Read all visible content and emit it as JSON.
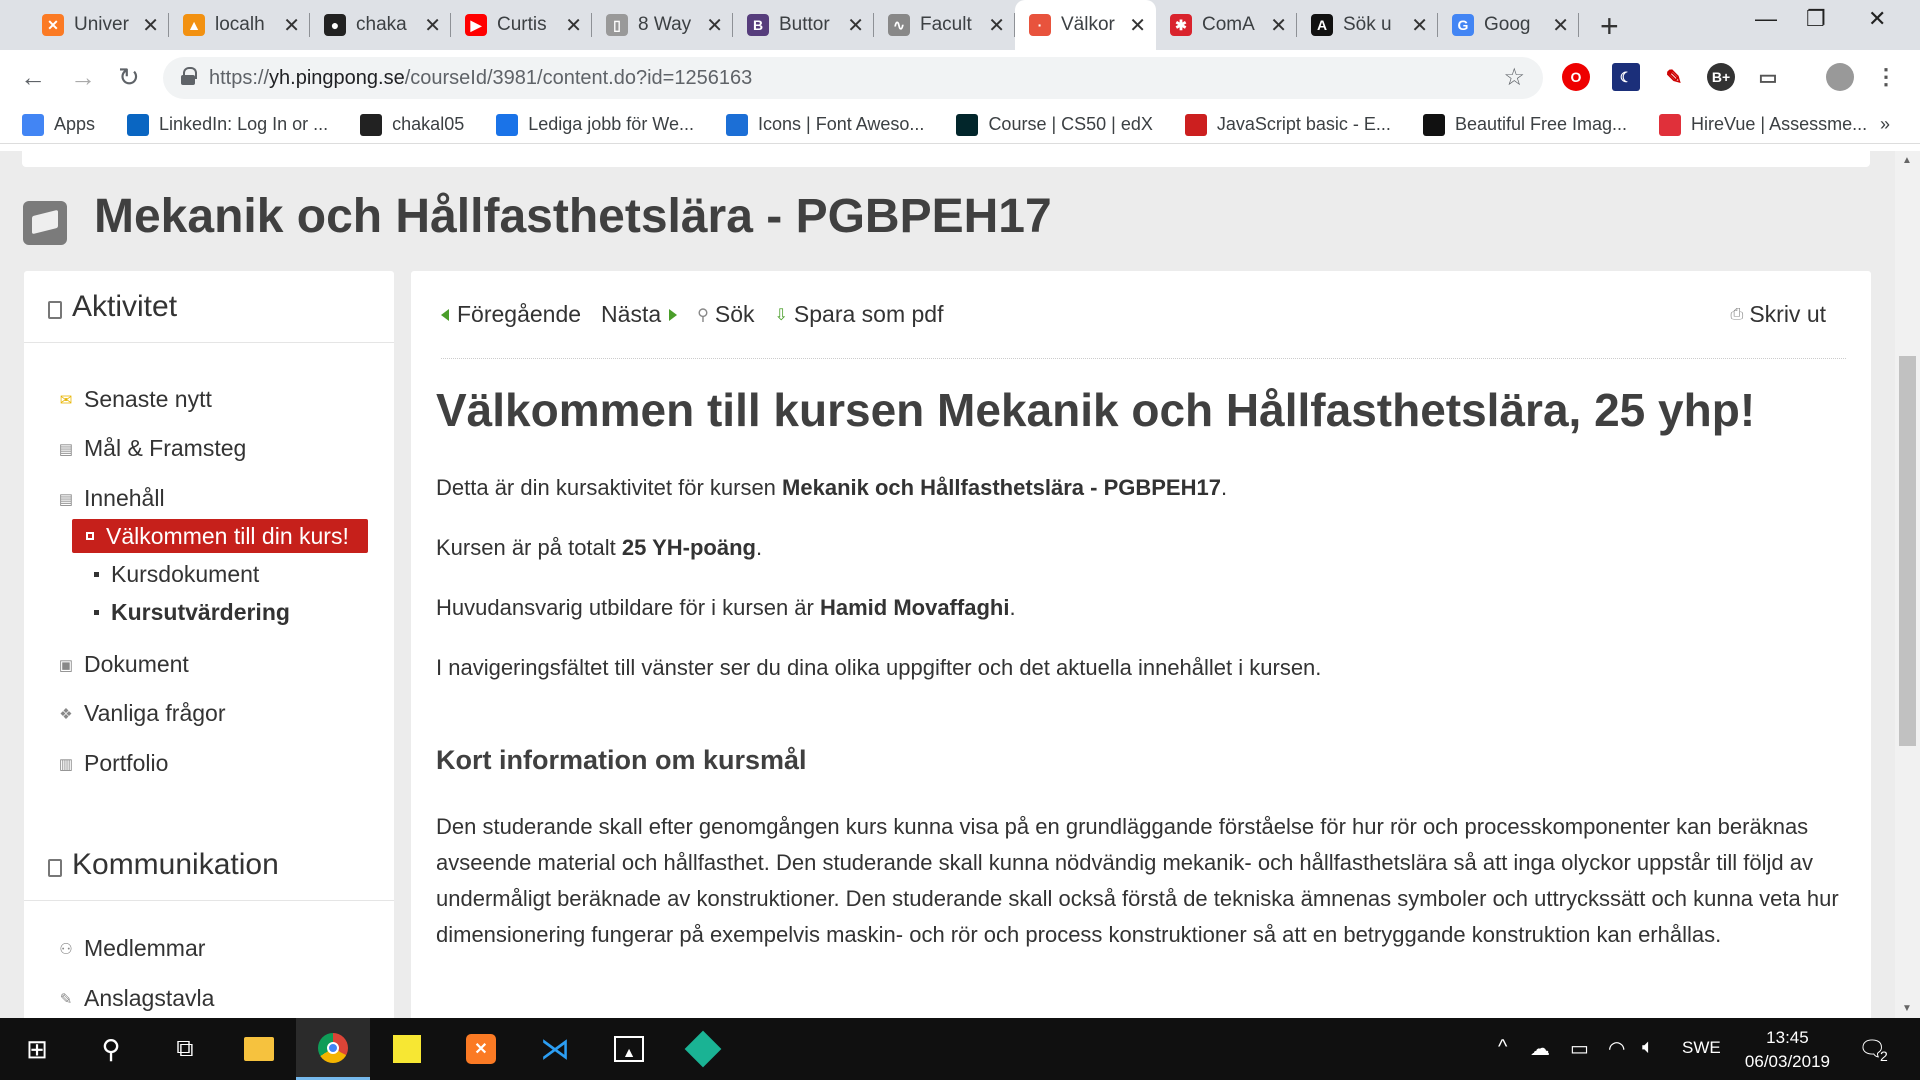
{
  "browser": {
    "tabs": [
      {
        "title": "Univer",
        "icon": "xampp-icon",
        "color": "#fb7a24",
        "glyph": "✕"
      },
      {
        "title": "localh",
        "icon": "phpmyadmin-icon",
        "color": "#f29111",
        "glyph": "▲"
      },
      {
        "title": "chaka",
        "icon": "github-icon",
        "color": "#222222",
        "glyph": "●"
      },
      {
        "title": "Curtis",
        "icon": "youtube-icon",
        "color": "#ff0000",
        "glyph": "▶"
      },
      {
        "title": "8 Way",
        "icon": "document-icon",
        "color": "#999999",
        "glyph": "▯"
      },
      {
        "title": "Buttor",
        "icon": "bootstrap-icon",
        "color": "#563d7c",
        "glyph": "B"
      },
      {
        "title": "Facult",
        "icon": "chart-icon",
        "color": "#888888",
        "glyph": "∿"
      },
      {
        "title": "Välkor",
        "icon": "pingpong-icon",
        "color": "#e8533d",
        "glyph": "·"
      },
      {
        "title": "ComA",
        "icon": "star-logo-icon",
        "color": "#d9232d",
        "glyph": "✱"
      },
      {
        "title": "Sök u",
        "icon": "search-logo-icon",
        "color": "#111111",
        "glyph": "A"
      },
      {
        "title": "Goog",
        "icon": "google-icon",
        "color": "#4285f4",
        "glyph": "G"
      }
    ],
    "url_prefix": "https://",
    "url_host": "yh.pingpong.se",
    "url_path": "/courseId/3981/content.do?id=1256163",
    "bookmarks": [
      {
        "label": "Apps",
        "icon": "apps-grid-icon",
        "color": "#4285f4"
      },
      {
        "label": "LinkedIn: Log In or ...",
        "icon": "linkedin-icon",
        "color": "#0a66c2"
      },
      {
        "label": "chakal05",
        "icon": "github-icon",
        "color": "#222222"
      },
      {
        "label": "Lediga jobb för We...",
        "icon": "job-icon",
        "color": "#1a73e8"
      },
      {
        "label": "Icons | Font Aweso...",
        "icon": "flag-icon",
        "color": "#1c6fd6"
      },
      {
        "label": "Course | CS50 | edX",
        "icon": "edx-icon",
        "color": "#02262b"
      },
      {
        "label": "JavaScript basic - E...",
        "icon": "w3resource-icon",
        "color": "#cc1f1f"
      },
      {
        "label": "Beautiful Free Imag...",
        "icon": "unsplash-icon",
        "color": "#111111"
      },
      {
        "label": "HireVue | Assessme...",
        "icon": "hirevue-icon",
        "color": "#e0303a"
      }
    ],
    "more_bookmarks": "»"
  },
  "course": {
    "title": "Mekanik och Hållfasthetslära - PGBPEH17"
  },
  "sidebar": {
    "activity_heading": "Aktivitet",
    "items": [
      {
        "label": "Senaste nytt",
        "icon": "news-icon"
      },
      {
        "label": "Mål & Framsteg",
        "icon": "goal-icon"
      },
      {
        "label": "Innehåll",
        "icon": "content-icon"
      },
      {
        "label": "Dokument",
        "icon": "document-icon"
      },
      {
        "label": "Vanliga frågor",
        "icon": "faq-icon"
      },
      {
        "label": "Portfolio",
        "icon": "portfolio-icon"
      }
    ],
    "subitems": [
      {
        "label": "Välkommen till din kurs!"
      },
      {
        "label": "Kursdokument"
      },
      {
        "label": "Kursutvärdering"
      }
    ],
    "comm_heading": "Kommunikation",
    "comm_items": [
      {
        "label": "Medlemmar",
        "icon": "members-icon"
      },
      {
        "label": "Anslagstavla",
        "icon": "pin-icon"
      }
    ]
  },
  "toolbar": {
    "prev": "Föregående",
    "next": "Nästa",
    "search": "Sök",
    "save_pdf": "Spara som pdf",
    "print": "Skriv ut"
  },
  "article": {
    "heading": "Välkommen till kursen Mekanik och Hållfasthetslära, 25 yhp!",
    "p1_text": "Detta är din kursaktivitet för kursen ",
    "p1_bold": "Mekanik och Hållfasthetslära - PGBPEH17",
    "p1_end": ".",
    "p2_text": "Kursen är på totalt ",
    "p2_bold": "25 YH-poäng",
    "p2_end": ".",
    "p3_text": "Huvudansvarig utbildare för i kursen är ",
    "p3_bold": "Hamid Movaffaghi",
    "p3_end": ".",
    "p4": "I navigeringsfältet till vänster ser du dina olika uppgifter och det aktuella innehållet i kursen.",
    "subheading": "Kort information om kursmål",
    "long_paragraph": "Den studerande skall efter genomgången kurs kunna visa på en grundläggande förståelse för hur rör och processkomponenter kan beräknas avseende material och hållfasthet. Den studerande skall kunna nödvändig mekanik- och hållfasthetslära så att inga olyckor uppstår till följd av undermåligt beräknade av konstruktioner. Den studerande skall också förstå de tekniska ämnenas symboler och uttryckssätt och kunna veta hur dimensionering fungerar på exempelvis maskin- och rör och process konstruktioner så att en betryggande konstruktion kan erhållas."
  },
  "taskbar": {
    "language": "SWE",
    "time": "13:45",
    "date": "06/03/2019",
    "notifications": "2"
  }
}
